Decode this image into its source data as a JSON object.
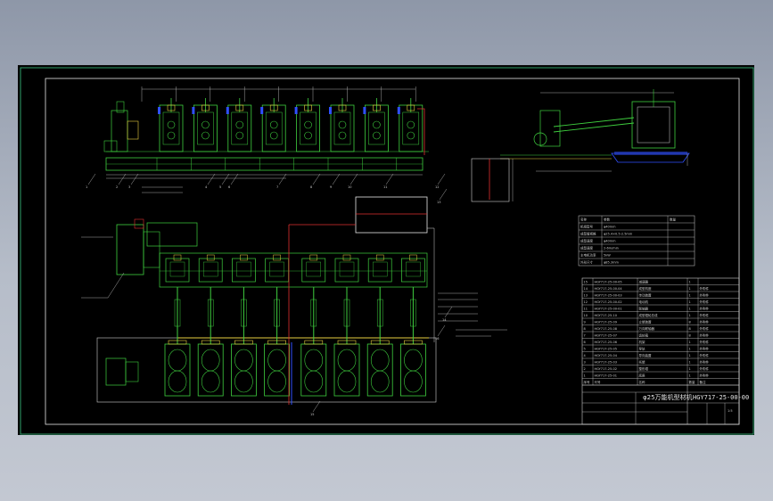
{
  "drawing": {
    "title": "φ25万能机型材机",
    "number": "HGY717-25-00-00",
    "sheet_scale": "1:5",
    "colors": {
      "background": "#000000",
      "frame": "#2fa06a",
      "machine": "#3fd03f",
      "frame_line": "#e8e8e8",
      "accent_red": "#e03030",
      "accent_blue": "#3050ff",
      "accent_yellow": "#e8d040",
      "table_line": "#d0d0d0"
    }
  },
  "spec_table": {
    "header": [
      "名称",
      "参数",
      "数量"
    ],
    "rows": [
      [
        "机组型号",
        "φ40mm",
        ""
      ],
      [
        "成型管规格",
        "φ25.4×0.5-2.5mm",
        ""
      ],
      [
        "成型速度",
        "φ40mm",
        ""
      ],
      [
        "成型速度",
        "2-6m/min",
        ""
      ],
      [
        "主电机功率",
        "5kW",
        ""
      ],
      [
        "外形尺寸",
        "φ85.3mm",
        ""
      ]
    ]
  },
  "parts_list": {
    "rows": [
      [
        "15",
        "HGY717-25-00-05",
        "减速器",
        "1",
        ""
      ],
      [
        "14",
        "HGY717-25-00-04",
        "成型机座",
        "1",
        "外购件"
      ],
      [
        "13",
        "HGY717-25-00-03",
        "传动装置",
        "1",
        "外购件"
      ],
      [
        "12",
        "HGY717-25-00-02",
        "电动机",
        "1",
        "外购件"
      ],
      [
        "11",
        "HGY717-25-00-01",
        "联轴器",
        "1",
        "外购件"
      ],
      [
        "10",
        "HGY717-25-10",
        "成型辊轮总成",
        "1",
        "外购件"
      ],
      [
        "9",
        "HGY717-25-09",
        "立辊装置",
        "8",
        "外购件"
      ],
      [
        "8",
        "HGY717-25-08",
        "万向联轴器",
        "8",
        "外购件"
      ],
      [
        "7",
        "HGY717-25-07",
        "齿轮箱",
        "8",
        "外购件"
      ],
      [
        "6",
        "HGY717-25-06",
        "机架",
        "1",
        "外购件"
      ],
      [
        "5",
        "HGY717-25-05",
        "导轨",
        "1",
        "外购件"
      ],
      [
        "4",
        "HGY717-25-04",
        "导向装置",
        "1",
        "外购件"
      ],
      [
        "3",
        "HGY717-25-03",
        "托辊",
        "1",
        "外购件"
      ],
      [
        "2",
        "HGY717-25-02",
        "整形辊",
        "1",
        "外购件"
      ],
      [
        "1",
        "HGY717-25-01",
        "底座",
        "1",
        "外购件"
      ]
    ],
    "header": [
      "序号",
      "代号",
      "名称",
      "数量",
      "备注"
    ]
  },
  "callouts": [
    "1",
    "2",
    "3",
    "4",
    "5",
    "6",
    "7",
    "8",
    "9",
    "10",
    "11",
    "12",
    "13",
    "14",
    "15",
    "16"
  ],
  "stand_count": 8
}
